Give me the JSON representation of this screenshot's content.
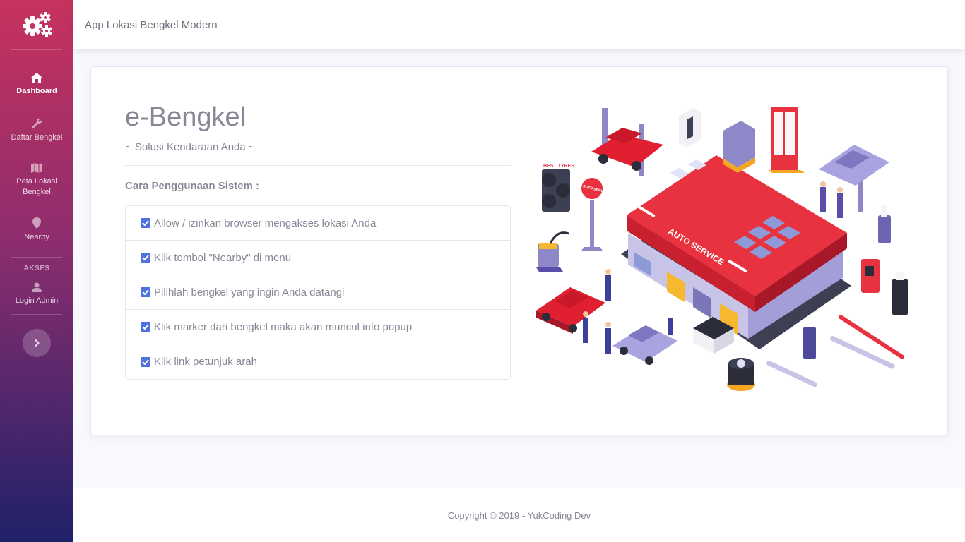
{
  "sidebar": {
    "brand_icon": "cogs-icon",
    "items": [
      {
        "label": "Dashboard",
        "icon": "home-icon",
        "active": true
      },
      {
        "label": "Daftar Bengkel",
        "icon": "wrench-icon"
      },
      {
        "label": "Peta Lokasi Bengkel",
        "icon": "map-icon"
      },
      {
        "label": "Nearby",
        "icon": "map-marker-icon"
      }
    ],
    "heading_akses": "AKSES",
    "login": {
      "label": "Login Admin",
      "icon": "user-icon"
    },
    "toggle_icon": "chevron-right-icon"
  },
  "topbar": {
    "title": "App Lokasi Bengkel Modern"
  },
  "hero": {
    "title": "e-Bengkel",
    "subtitle": "~ Solusi Kendaraan Anda ~",
    "steps_title": "Cara Penggunaan Sistem :",
    "steps": [
      "Allow / izinkan browser mengakses lokasi Anda",
      "Klik tombol \"Nearby\" di menu",
      "Pilihlah bengkel yang ingin Anda datangi",
      "Klik marker dari bengkel maka akan muncul info popup",
      "Klik link petunjuk arah"
    ],
    "illustration": {
      "sign_text": "AUTO SERVICE",
      "pole_sign": "AUTO SERVICE",
      "tire_sign": "BEST TYRES"
    }
  },
  "footer": {
    "copyright": "Copyright © 2019 - YukCoding Dev"
  },
  "colors": {
    "primary": "#4e73df",
    "text": "#858796",
    "sidebar_top": "#c7325e",
    "sidebar_bottom": "#1f2169"
  }
}
